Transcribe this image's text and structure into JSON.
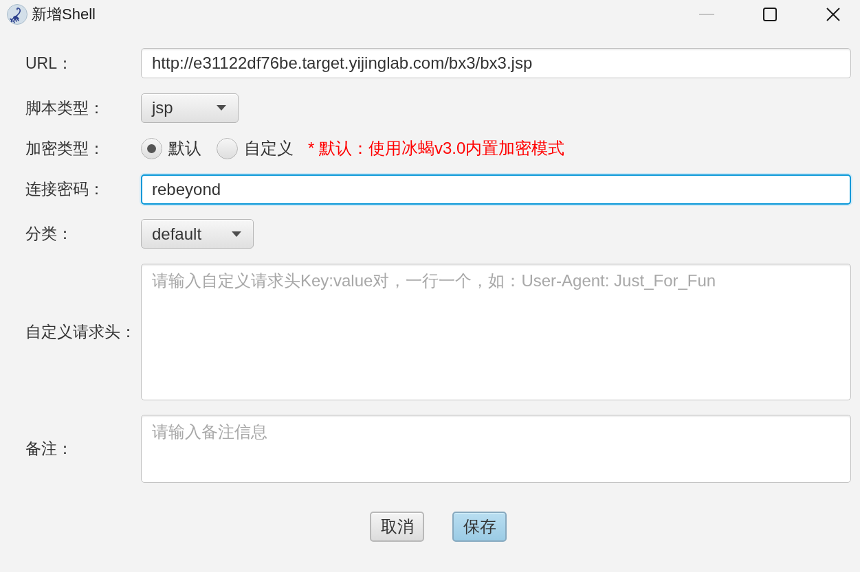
{
  "window": {
    "title": "新增Shell",
    "controls": [
      {
        "kind": "minimize",
        "disabled": true
      },
      {
        "kind": "maximize",
        "disabled": false
      },
      {
        "kind": "close",
        "disabled": false
      }
    ]
  },
  "fields": [
    {
      "kind": "text",
      "label": "URL：",
      "value": "http://e31122df76be.target.yijinglab.com/bx3/bx3.jsp",
      "focused": false
    },
    {
      "kind": "select",
      "label": "脚本类型：",
      "value": "jsp"
    },
    {
      "kind": "radio",
      "label": "加密类型：",
      "options": [
        {
          "label": "默认",
          "selected": true
        },
        {
          "label": "自定义",
          "selected": false
        }
      ],
      "note": "* 默认：使用冰蝎v3.0内置加密模式"
    },
    {
      "kind": "text",
      "label": "连接密码：",
      "value": "rebeyond",
      "focused": true
    },
    {
      "kind": "select",
      "label": "分类：",
      "value": "default"
    },
    {
      "kind": "textarea",
      "label": "自定义请求头：",
      "placeholder": "请输入自定义请求头Key:value对，一行一个，如：User-Agent: Just_For_Fun"
    },
    {
      "kind": "textarea",
      "label": "备注：",
      "placeholder": "请输入备注信息"
    }
  ],
  "buttons": [
    {
      "label": "取消",
      "default": false
    },
    {
      "label": "保存",
      "default": true
    }
  ]
}
